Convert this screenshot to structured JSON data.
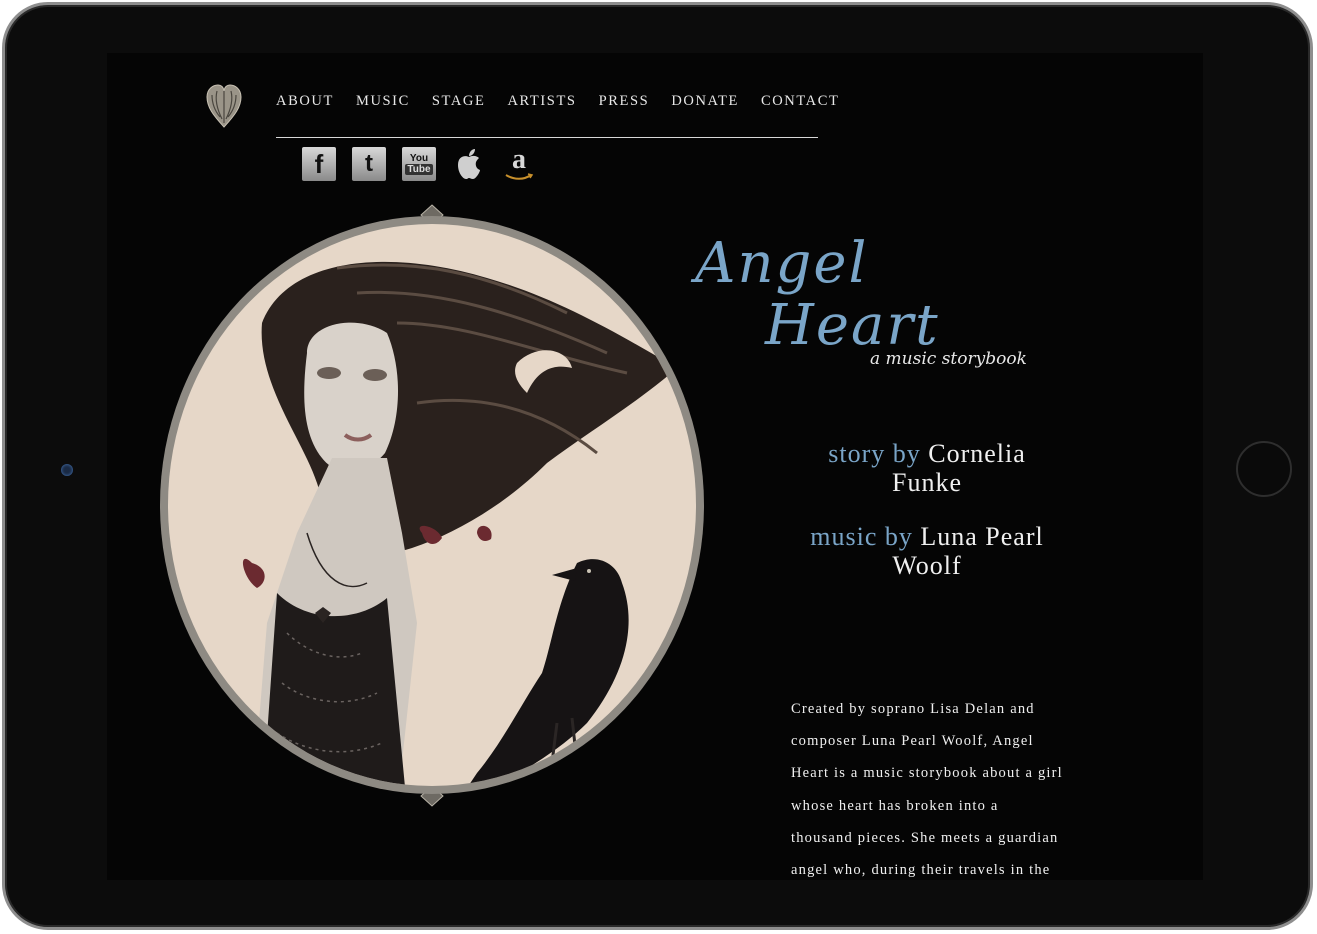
{
  "nav": {
    "items": [
      "ABOUT",
      "MUSIC",
      "STAGE",
      "ARTISTS",
      "PRESS",
      "DONATE",
      "CONTACT"
    ]
  },
  "social": {
    "items": [
      {
        "icon": "facebook-icon",
        "glyph": "f"
      },
      {
        "icon": "twitter-icon",
        "glyph": "t"
      },
      {
        "icon": "youtube-icon",
        "glyph_top": "You",
        "glyph_bottom": "Tube"
      },
      {
        "icon": "apple-icon",
        "glyph": ""
      },
      {
        "icon": "amazon-icon",
        "glyph": "a"
      }
    ]
  },
  "title": {
    "line1": "Angel",
    "line2": "Heart",
    "subtitle": "a music storybook"
  },
  "credits": {
    "story_role": "story by",
    "story_name_1": "Cornelia",
    "story_name_2": "Funke",
    "music_role": "music by",
    "music_name_1": "Luna Pearl",
    "music_name_2": "Woolf"
  },
  "description": {
    "lines": [
      "Created by soprano Lisa Delan and",
      "composer Luna Pearl Woolf, Angel",
      "Heart is a music storybook about a girl",
      "whose heart has broken into a",
      "thousand pieces. She meets a guardian",
      "angel who, during their travels in the"
    ]
  },
  "colors": {
    "accent": "#7aa5c8",
    "background": "#050505",
    "text": "#f0f0f0"
  }
}
